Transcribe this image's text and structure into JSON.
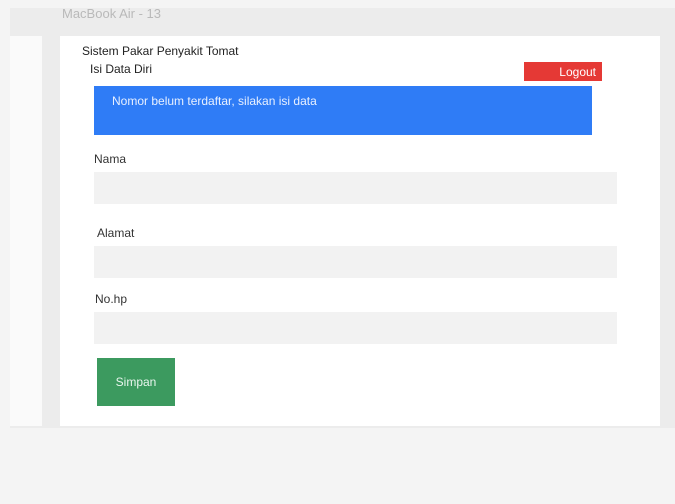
{
  "frame": {
    "label": "MacBook Air - 13"
  },
  "app": {
    "title": "Sistem Pakar Penyakit Tomat",
    "section_title": "Isi Data Diri",
    "logout_label": "Logout"
  },
  "alert": {
    "message": "Nomor belum terdaftar, silakan isi data"
  },
  "form": {
    "fields": [
      {
        "label": "Nama",
        "value": "",
        "placeholder": ""
      },
      {
        "label": "Alamat",
        "value": "",
        "placeholder": ""
      },
      {
        "label": "No.hp",
        "value": "",
        "placeholder": ""
      }
    ],
    "submit_label": "Simpan"
  },
  "colors": {
    "logout": "#e53935",
    "alert": "#2f7cf6",
    "submit": "#3c9a5f",
    "input_bg": "#f2f2f2"
  }
}
